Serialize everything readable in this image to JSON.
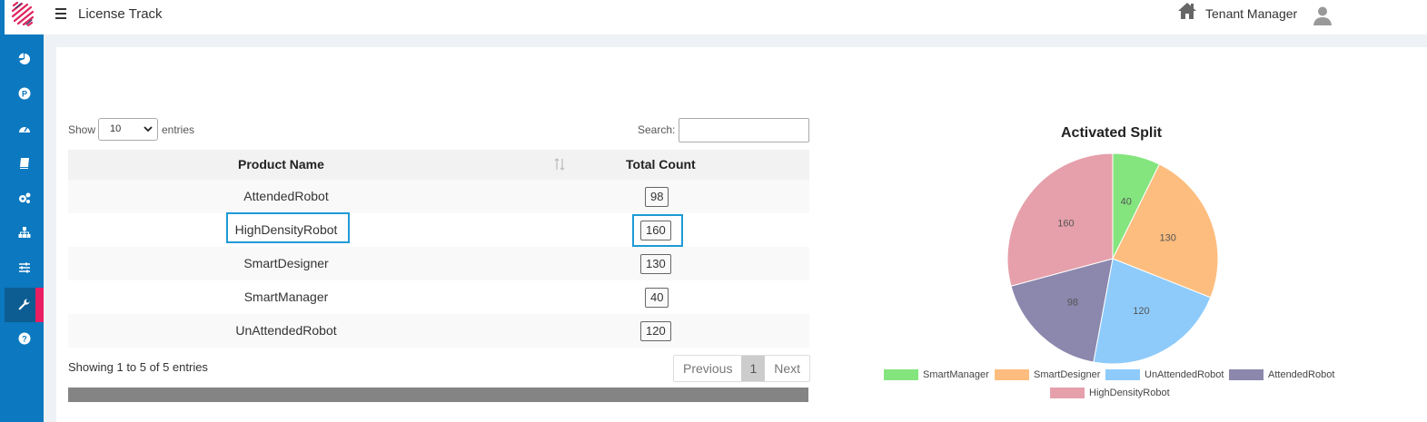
{
  "header": {
    "app_title": "License Track",
    "tenant_label": "Tenant Manager"
  },
  "sidebar": {
    "items": [
      {
        "icon": "pie-chart-icon"
      },
      {
        "icon": "parking-icon"
      },
      {
        "icon": "dashboard-icon"
      },
      {
        "icon": "book-icon"
      },
      {
        "icon": "cogs-icon"
      },
      {
        "icon": "sitemap-icon"
      },
      {
        "icon": "sliders-icon"
      },
      {
        "icon": "wrench-icon",
        "active": true
      },
      {
        "icon": "help-icon"
      }
    ]
  },
  "table_controls": {
    "show_label": "Show",
    "entries_value": "10",
    "entries_label": "entries",
    "search_label": "Search:",
    "search_value": ""
  },
  "table": {
    "columns": [
      "Product Name",
      "Total Count"
    ],
    "rows": [
      {
        "name": "AttendedRobot",
        "count": "98"
      },
      {
        "name": "HighDensityRobot",
        "count": "160"
      },
      {
        "name": "SmartDesigner",
        "count": "130"
      },
      {
        "name": "SmartManager",
        "count": "40"
      },
      {
        "name": "UnAttendedRobot",
        "count": "120"
      }
    ],
    "info": "Showing 1 to 5 of 5 entries",
    "pagination": {
      "previous": "Previous",
      "current": "1",
      "next": "Next"
    }
  },
  "chart_data": {
    "type": "pie",
    "title": "Activated Split",
    "categories": [
      "SmartManager",
      "SmartDesigner",
      "UnAttendedRobot",
      "AttendedRobot",
      "HighDensityRobot"
    ],
    "values": [
      40,
      130,
      120,
      98,
      160
    ],
    "colors": [
      "#84e57e",
      "#fdbd7e",
      "#8ecbfb",
      "#8b87ad",
      "#e6a0ab"
    ],
    "legend_position": "bottom"
  },
  "colors": {
    "sidebar": "#0b78bf",
    "sidebar_active_marker": "#ea1e63",
    "highlight": "#1f9ad6"
  }
}
